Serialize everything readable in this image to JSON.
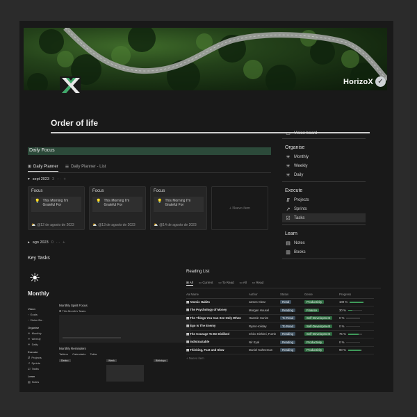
{
  "brand": {
    "name": "HorizoX"
  },
  "page": {
    "title": "Order of life"
  },
  "sidebar": {
    "top_item": "Vision board",
    "sections": [
      {
        "heading": "Organise",
        "items": [
          {
            "label": "Monthly",
            "icon": "sun-icon"
          },
          {
            "label": "Weekly",
            "icon": "sun-icon"
          },
          {
            "label": "Daily",
            "icon": "sun-icon"
          }
        ]
      },
      {
        "heading": "Execute",
        "items": [
          {
            "label": "Projects",
            "icon": "projects-icon"
          },
          {
            "label": "Sprints",
            "icon": "chart-icon"
          },
          {
            "label": "Tasks",
            "icon": "checkbox-icon"
          }
        ]
      },
      {
        "heading": "Learn",
        "items": [
          {
            "label": "Notes",
            "icon": "note-icon"
          },
          {
            "label": "Books",
            "icon": "book-icon"
          }
        ]
      }
    ]
  },
  "daily_focus": {
    "title": "Daily Focus",
    "tabs": [
      {
        "label": "Daily Planner"
      },
      {
        "label": "Daily Planner - List"
      }
    ],
    "group1": {
      "label": "sept 2023",
      "count": "3",
      "more": "···",
      "add": "+"
    },
    "group2": {
      "label": "ago 2023",
      "count": "0",
      "more": "···",
      "add": "+"
    },
    "cards": [
      {
        "title": "Focus",
        "text": "This Morning I'm Grateful For",
        "date": "@12 de agosto de 2023"
      },
      {
        "title": "Focus",
        "text": "This Morning I'm Grateful For",
        "date": "@13 de agosto de 2023"
      },
      {
        "title": "Focus",
        "text": "This Morning I'm Grateful For",
        "date": "@14 de agosto de 2023"
      }
    ],
    "new_item": "+ Nuevo ítem"
  },
  "key_tasks": {
    "title": "Key Tasks"
  },
  "monthly": {
    "title": "Monthly",
    "nav": [
      {
        "h": "Vision"
      },
      {
        "i": "Goals"
      },
      {
        "i": "Vision Bo.."
      },
      {
        "h": "Organise"
      },
      {
        "i": "Monthly"
      },
      {
        "i": "Weekly"
      },
      {
        "i": "Daily"
      },
      {
        "h": "Execute"
      },
      {
        "i": "Projects"
      },
      {
        "i": "Sprints"
      },
      {
        "i": "Tasks"
      },
      {
        "h": "Learn"
      },
      {
        "i": "Notes"
      }
    ],
    "spirit_focus": "Monthly Spirit Focus",
    "month_tasks": "This Month's Tasks",
    "reminders": "Monthly Reminders",
    "reminder_tabs": [
      "Tablero",
      "Calendario",
      "Tabla"
    ],
    "cols": [
      "Dentro",
      "Week",
      "Birthdays"
    ]
  },
  "reading_list": {
    "title": "Reading List",
    "tabs": [
      "All",
      "Current",
      "To Read",
      "All",
      "Read"
    ],
    "columns": [
      "Aa Name",
      "Author",
      "Status",
      "Genre",
      "Progress"
    ],
    "rows": [
      {
        "name": "Atomic Habits",
        "author": "James Clear",
        "status": "Read",
        "genre": "Productivity",
        "progress": "100 %",
        "pct": 100
      },
      {
        "name": "The Psychology of Money",
        "author": "Morgan Housel",
        "status": "Reading",
        "genre": "Finance",
        "progress": "30 %",
        "pct": 30
      },
      {
        "name": "The Things You Can See Only When",
        "author": "Haemin Sunim",
        "status": "To Read",
        "genre": "Self-Development",
        "progress": "0 %",
        "pct": 0
      },
      {
        "name": "Ego Is The Enemy",
        "author": "Ryan Holiday",
        "status": "To Read",
        "genre": "Self-Development",
        "progress": "0 %",
        "pct": 0
      },
      {
        "name": "The Courage To Be Disliked",
        "author": "Ichiro Kishimi, Fumit",
        "status": "Reading",
        "genre": "Self-Development",
        "progress": "75 %",
        "pct": 75
      },
      {
        "name": "Indistractable",
        "author": "Nir Eyal",
        "status": "Reading",
        "genre": "Productivity",
        "progress": "0 %",
        "pct": 0
      },
      {
        "name": "Thinking, Fast and Slow",
        "author": "Daniel Kahneman",
        "status": "Reading",
        "genre": "Productivity",
        "progress": "90 %",
        "pct": 90
      }
    ],
    "new_row": "+ Nuevo ítem"
  },
  "colors": {
    "accent_green": "#2c4a3a",
    "genre_green": "#2e6a40",
    "status_blue": "#3d4e5c"
  }
}
